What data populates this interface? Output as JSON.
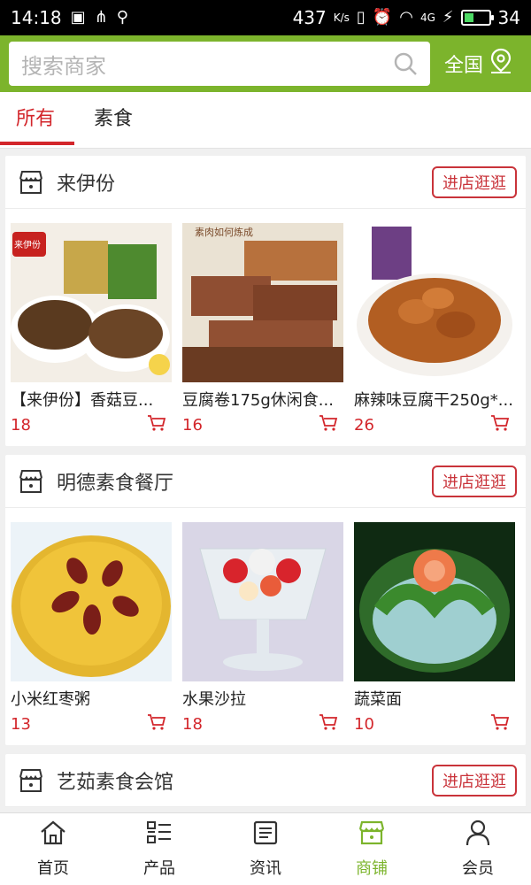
{
  "status_bar": {
    "time": "14:18",
    "net_speed": "437",
    "net_unit": "K/s",
    "signal": "4G",
    "battery": "34",
    "battery_level": 0.34
  },
  "search": {
    "placeholder": "搜索商家",
    "region_label": "全国"
  },
  "tabs": [
    {
      "label": "所有",
      "active": true
    },
    {
      "label": "素食",
      "active": false
    }
  ],
  "shops": [
    {
      "name": "来伊份",
      "visit_label": "进店逛逛",
      "products": [
        {
          "name": "【来伊份】香菇豆...",
          "price": "18",
          "thumb_badge": "来伊份"
        },
        {
          "name": "豆腐卷175g休闲食...",
          "price": "16",
          "thumb_caption": "素肉如何炼成"
        },
        {
          "name": "麻辣味豆腐干250g*...",
          "price": "26"
        }
      ]
    },
    {
      "name": "明德素食餐厅",
      "visit_label": "进店逛逛",
      "products": [
        {
          "name": "小米红枣粥",
          "price": "13"
        },
        {
          "name": "水果沙拉",
          "price": "18"
        },
        {
          "name": "蔬菜面",
          "price": "10"
        }
      ]
    },
    {
      "name": "艺茹素食会馆",
      "visit_label": "进店逛逛",
      "products": []
    }
  ],
  "bottom_nav": [
    {
      "label": "首页",
      "icon": "home-icon",
      "active": false
    },
    {
      "label": "产品",
      "icon": "products-icon",
      "active": false
    },
    {
      "label": "资讯",
      "icon": "news-icon",
      "active": false
    },
    {
      "label": "商铺",
      "icon": "shop-icon",
      "active": true
    },
    {
      "label": "会员",
      "icon": "member-icon",
      "active": false
    }
  ],
  "colors": {
    "brand_green": "#7cb42c",
    "accent_red": "#d3262b"
  }
}
